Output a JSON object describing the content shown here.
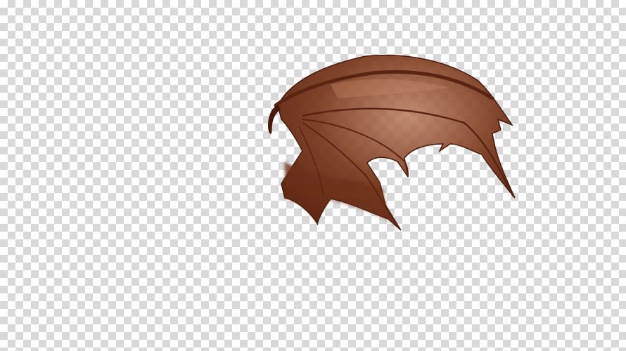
{
  "image": {
    "subject": "dragon-wing",
    "background": "transparency-checkerboard",
    "colors": {
      "checker_light": "#ffffff",
      "checker_dark": "#d9d9d9",
      "membrane": "#6b2f18",
      "membrane_light": "#9a5235",
      "bone": "#5a2412",
      "claw": "#4a1a0c"
    }
  }
}
